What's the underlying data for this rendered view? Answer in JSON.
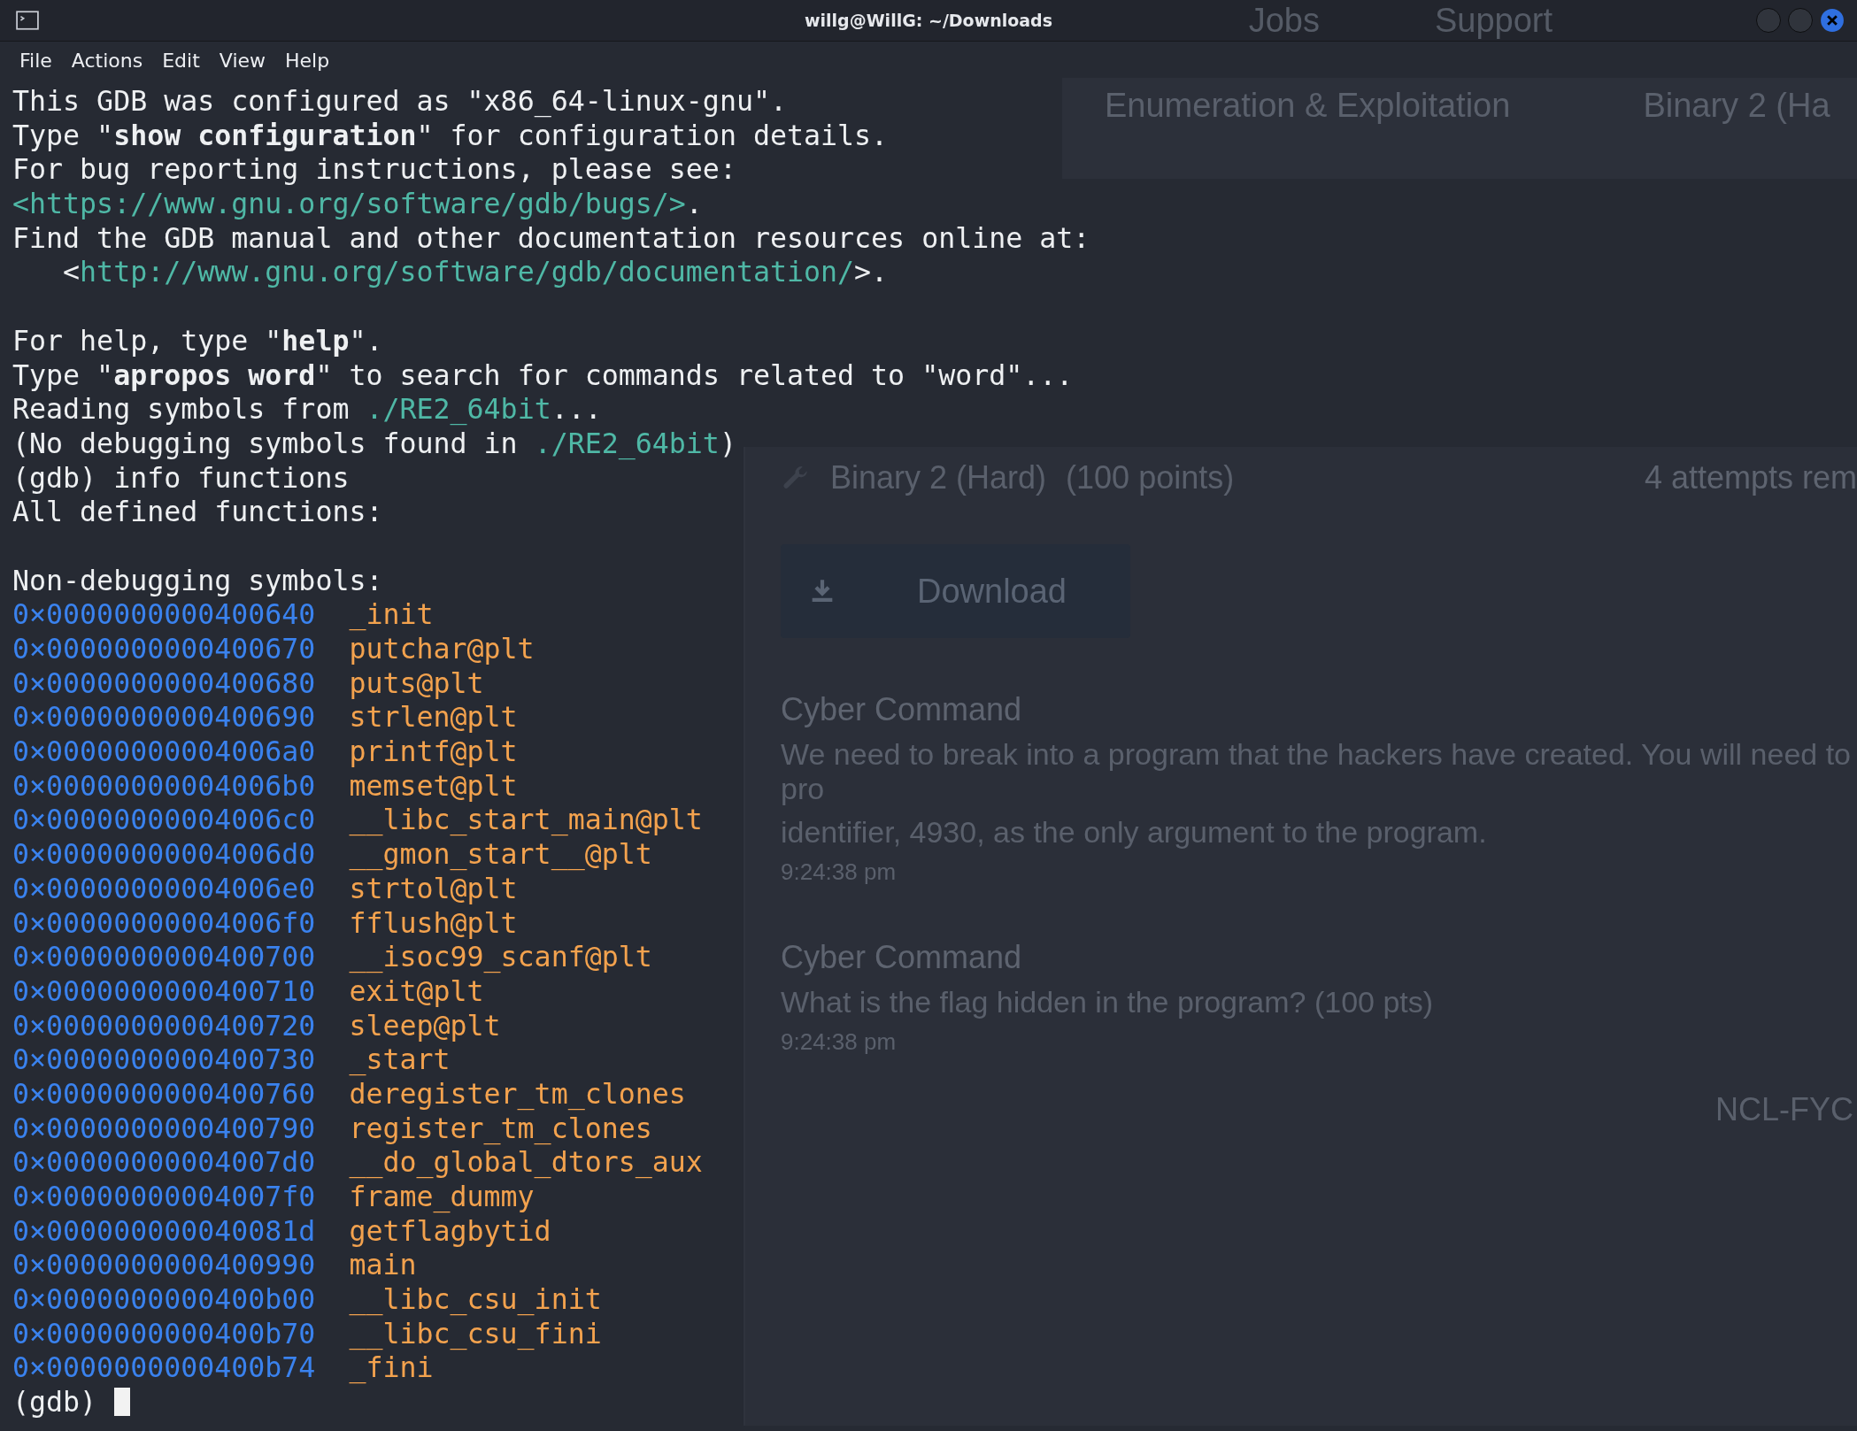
{
  "window": {
    "title": "willg@WillG: ~/Downloads"
  },
  "menu": [
    "File",
    "Actions",
    "Edit",
    "View",
    "Help"
  ],
  "lines": [
    {
      "kind": "text",
      "segments": [
        {
          "kind": "plain",
          "text": "This GDB was configured as \"x86_64-linux-gnu\"."
        }
      ]
    },
    {
      "kind": "text",
      "segments": [
        {
          "kind": "plain",
          "text": "Type \"**show configuration**\" for configuration details."
        }
      ]
    },
    {
      "kind": "text",
      "segments": [
        {
          "kind": "plain",
          "text": "For bug reporting instructions, please see:"
        }
      ]
    },
    {
      "kind": "text",
      "segments": [
        {
          "kind": "link",
          "text": "<https://www.gnu.org/software/gdb/bugs/>"
        },
        {
          "kind": "plain",
          "text": "."
        }
      ]
    },
    {
      "kind": "text",
      "segments": [
        {
          "kind": "plain",
          "text": "Find the GDB manual and other documentation resources online at:"
        }
      ]
    },
    {
      "kind": "text",
      "segments": [
        {
          "kind": "plain",
          "text": "   <"
        },
        {
          "kind": "link",
          "text": "http://www.gnu.org/software/gdb/documentation/"
        },
        {
          "kind": "plain",
          "text": ">."
        }
      ]
    },
    {
      "kind": "blank"
    },
    {
      "kind": "text",
      "segments": [
        {
          "kind": "plain",
          "text": "For help, type \"**help**\"."
        }
      ]
    },
    {
      "kind": "text",
      "segments": [
        {
          "kind": "plain",
          "text": "Type \"**apropos word**\" to search for commands related to \"word\"..."
        }
      ]
    },
    {
      "kind": "text",
      "segments": [
        {
          "kind": "plain",
          "text": "Reading symbols from "
        },
        {
          "kind": "link",
          "text": "./RE2_64bit"
        },
        {
          "kind": "plain",
          "text": "..."
        }
      ]
    },
    {
      "kind": "text",
      "segments": [
        {
          "kind": "plain",
          "text": "(No debugging symbols found in "
        },
        {
          "kind": "link",
          "text": "./RE2_64bit"
        },
        {
          "kind": "plain",
          "text": ")"
        }
      ]
    },
    {
      "kind": "text",
      "segments": [
        {
          "kind": "plain",
          "text": "(gdb) info functions"
        }
      ]
    },
    {
      "kind": "text",
      "segments": [
        {
          "kind": "plain",
          "text": "All defined functions:"
        }
      ]
    },
    {
      "kind": "blank"
    },
    {
      "kind": "text",
      "segments": [
        {
          "kind": "plain",
          "text": "Non-debugging symbols:"
        }
      ]
    },
    {
      "kind": "symbol",
      "address": "0×0000000000400640",
      "symbol": "_init"
    },
    {
      "kind": "symbol",
      "address": "0×0000000000400670",
      "symbol": "putchar@plt"
    },
    {
      "kind": "symbol",
      "address": "0×0000000000400680",
      "symbol": "puts@plt"
    },
    {
      "kind": "symbol",
      "address": "0×0000000000400690",
      "symbol": "strlen@plt"
    },
    {
      "kind": "symbol",
      "address": "0×00000000004006a0",
      "symbol": "printf@plt"
    },
    {
      "kind": "symbol",
      "address": "0×00000000004006b0",
      "symbol": "memset@plt"
    },
    {
      "kind": "symbol",
      "address": "0×00000000004006c0",
      "symbol": "__libc_start_main@plt"
    },
    {
      "kind": "symbol",
      "address": "0×00000000004006d0",
      "symbol": "__gmon_start__@plt"
    },
    {
      "kind": "symbol",
      "address": "0×00000000004006e0",
      "symbol": "strtol@plt"
    },
    {
      "kind": "symbol",
      "address": "0×00000000004006f0",
      "symbol": "fflush@plt"
    },
    {
      "kind": "symbol",
      "address": "0×0000000000400700",
      "symbol": "__isoc99_scanf@plt"
    },
    {
      "kind": "symbol",
      "address": "0×0000000000400710",
      "symbol": "exit@plt"
    },
    {
      "kind": "symbol",
      "address": "0×0000000000400720",
      "symbol": "sleep@plt"
    },
    {
      "kind": "symbol",
      "address": "0×0000000000400730",
      "symbol": "_start"
    },
    {
      "kind": "symbol",
      "address": "0×0000000000400760",
      "symbol": "deregister_tm_clones"
    },
    {
      "kind": "symbol",
      "address": "0×0000000000400790",
      "symbol": "register_tm_clones"
    },
    {
      "kind": "symbol",
      "address": "0×00000000004007d0",
      "symbol": "__do_global_dtors_aux"
    },
    {
      "kind": "symbol",
      "address": "0×00000000004007f0",
      "symbol": "frame_dummy"
    },
    {
      "kind": "symbol",
      "address": "0×000000000040081d",
      "symbol": "getflagbytid"
    },
    {
      "kind": "symbol",
      "address": "0×0000000000400990",
      "symbol": "main"
    },
    {
      "kind": "symbol",
      "address": "0×0000000000400b00",
      "symbol": "__libc_csu_init"
    },
    {
      "kind": "symbol",
      "address": "0×0000000000400b70",
      "symbol": "__libc_csu_fini"
    },
    {
      "kind": "symbol",
      "address": "0×0000000000400b74",
      "symbol": "_fini"
    },
    {
      "kind": "prompt",
      "text": "(gdb)"
    }
  ],
  "background_page": {
    "nav": [
      "Jobs",
      "Support"
    ],
    "tabs": [
      "Enumeration & Exploitation",
      "Binary 2 (Ha"
    ],
    "challenge": {
      "title": "Binary 2 (Hard)",
      "points": "(100 points)",
      "attempts": "4 attempts rem"
    },
    "download": "Download",
    "messages": [
      {
        "sender": "Cyber Command",
        "text": "We need to break into a program that the hackers have created. You will need to pro",
        "text_2": "identifier, 4930, as the only argument to the program.",
        "time": "9:24:38 pm"
      },
      {
        "sender": "Cyber Command",
        "text": "What is the flag hidden in the program? (100 pts)",
        "time": "9:24:38 pm"
      }
    ],
    "side_label": "NCL-FYC"
  }
}
